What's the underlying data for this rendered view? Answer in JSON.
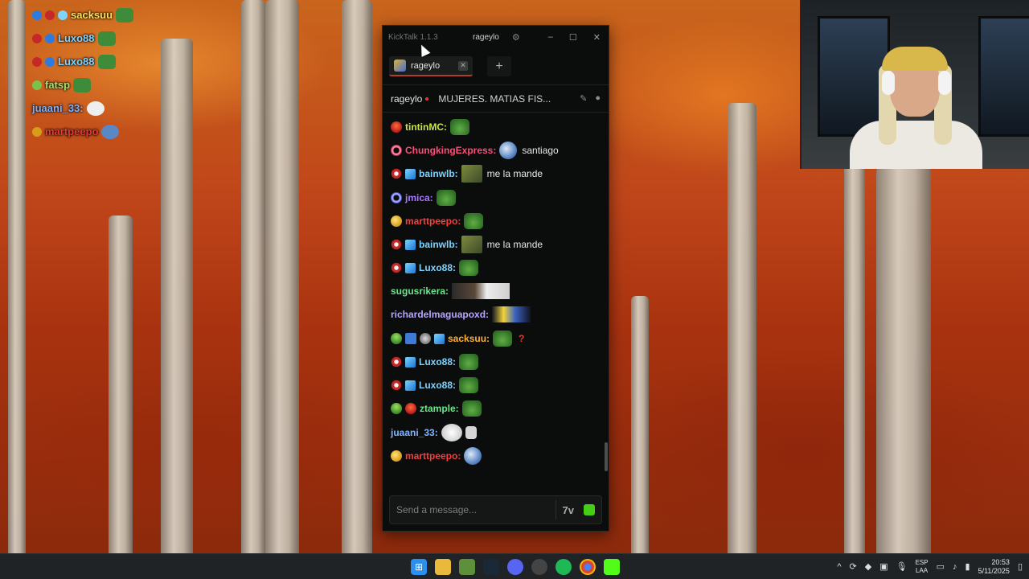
{
  "overlay_chat": {
    "rows": [
      {
        "user": "sacksuu",
        "color": "#ffe15a"
      },
      {
        "user": "Luxo88",
        "color": "#7fd3ff"
      },
      {
        "user": "Luxo88",
        "color": "#7fd3ff"
      },
      {
        "user": "fatsp",
        "color": "#a3e36b"
      },
      {
        "user": "juaani_33:",
        "color": "#7fb3ff"
      },
      {
        "user": "martpeepo",
        "color": "#e53935"
      }
    ]
  },
  "window": {
    "app_title": "KickTalk 1.1.3",
    "username": "rageylo",
    "controls": {
      "minimize": "–",
      "maximize": "☐",
      "close": "✕"
    }
  },
  "tabs": [
    {
      "label": "rageylo",
      "close": "✕"
    }
  ],
  "add_tab_label": "+",
  "chat_header": {
    "channel": "rageylo",
    "stream_title": "MUJERES. MATIAS FIS..."
  },
  "messages": [
    {
      "user": "tintinMC:",
      "color": "#cde44a",
      "text": ""
    },
    {
      "user": "ChungkingExpress:",
      "color": "#ff4d7a",
      "text": "santiago"
    },
    {
      "user": "bainwlb:",
      "color": "#7fd3ff",
      "text": "me la mande"
    },
    {
      "user": "jmica:",
      "color": "#a678ff",
      "text": ""
    },
    {
      "user": "marttpeepo:",
      "color": "#ff3b3b",
      "text": ""
    },
    {
      "user": "bainwlb:",
      "color": "#7fd3ff",
      "text": "me la mande"
    },
    {
      "user": "Luxo88:",
      "color": "#7fd3ff",
      "text": ""
    },
    {
      "user": "sugusrikera:",
      "color": "#6be58b",
      "text": ""
    },
    {
      "user": "richardelmaguapoxd:",
      "color": "#b8a6ff",
      "text": ""
    },
    {
      "user": "sacksuu:",
      "color": "#ffb02e",
      "text": "?"
    },
    {
      "user": "Luxo88:",
      "color": "#7fd3ff",
      "text": ""
    },
    {
      "user": "Luxo88:",
      "color": "#7fd3ff",
      "text": ""
    },
    {
      "user": "ztample:",
      "color": "#6be58b",
      "text": ""
    },
    {
      "user": "juaani_33:",
      "color": "#7fb3ff",
      "text": ""
    },
    {
      "user": "marttpeepo:",
      "color": "#ff3b3b",
      "text": ""
    }
  ],
  "input": {
    "placeholder": "Send a message...",
    "seven_tv_label": "7v"
  },
  "taskbar": {
    "lang_top": "ESP",
    "lang_bottom": "LAA",
    "time": "20:53",
    "date": "5/11/2025"
  },
  "colors": {
    "kick_green": "#53fc18",
    "window_bg": "#0b0d0c",
    "tab_accent": "#b53b2a"
  }
}
